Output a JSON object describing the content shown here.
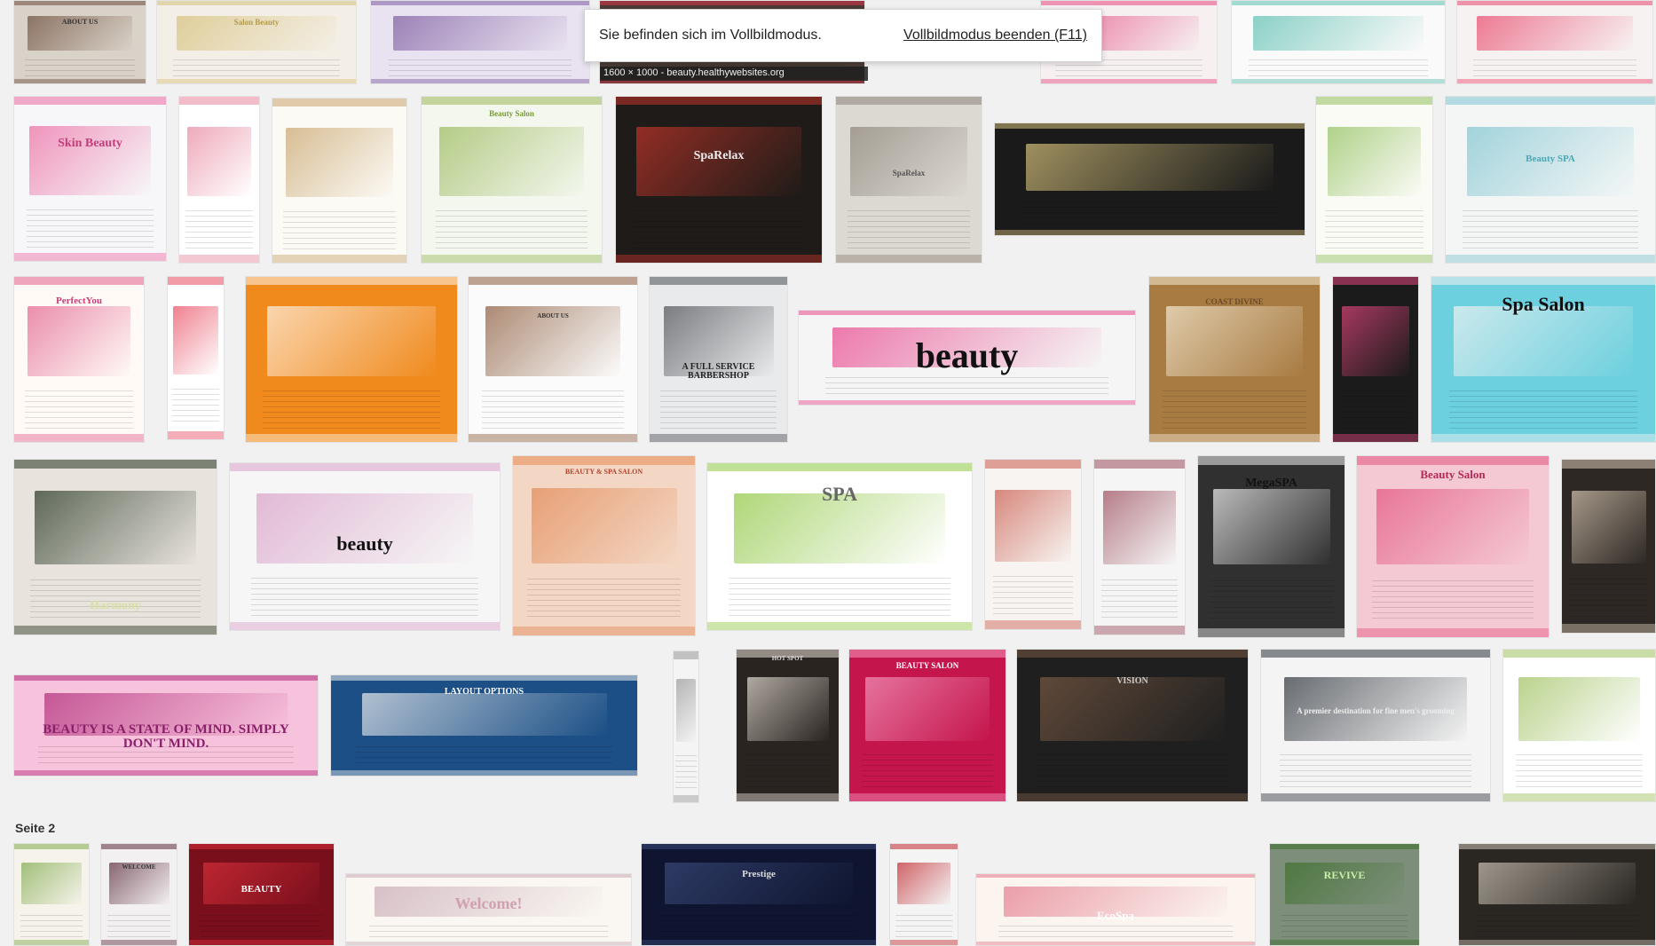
{
  "fullscreen_notice": {
    "message": "Sie befinden sich im Vollbildmodus.",
    "exit_label": "Vollbildmodus beenden (F11)"
  },
  "hover_caption": "1600 × 1000 - beauty.healthywebsites.org",
  "section_label": "Seite 2",
  "thumbnails": [
    {
      "bg": "#d9d2c8",
      "accent": "#6b4b3a",
      "text": "ABOUT US",
      "tc": "#333",
      "tsize": 8,
      "tpos": 22
    },
    {
      "bg": "#f4efe6",
      "accent": "#d6c07a",
      "text": "Salon Beauty",
      "tc": "#b69a4a",
      "tsize": 9,
      "tpos": 22
    },
    {
      "bg": "#e9e2f0",
      "accent": "#7b5aa0",
      "text": "",
      "tc": "#333",
      "tsize": 8,
      "tpos": 40
    },
    {
      "bg": "#4a3c35",
      "accent": "#d8324a",
      "text": "",
      "tc": "#fff",
      "tsize": 8,
      "tpos": 40
    },
    {
      "bg": "#f6f0f1",
      "accent": "#e6457e",
      "text": "",
      "tc": "#333",
      "tsize": 8,
      "tpos": 40
    },
    {
      "bg": "#fafafa",
      "accent": "#5bbfb0",
      "text": "",
      "tc": "#333",
      "tsize": 8,
      "tpos": 40
    },
    {
      "bg": "#f7f2f2",
      "accent": "#e8466a",
      "text": "",
      "tc": "#333",
      "tsize": 8,
      "tpos": 40
    },
    {
      "bg": "#f7f7f9",
      "accent": "#ec6aa2",
      "text": "Skin Beauty",
      "tc": "#c23e7a",
      "tsize": 14,
      "tpos": 25
    },
    {
      "bg": "#fff",
      "accent": "#e7859d",
      "text": "",
      "tc": "#333",
      "tsize": 8,
      "tpos": 40
    },
    {
      "bg": "#fcfaf5",
      "accent": "#c7a36a",
      "text": "",
      "tc": "#333",
      "tsize": 8,
      "tpos": 40
    },
    {
      "bg": "#f3f7ee",
      "accent": "#9ab95a",
      "text": "Beauty Salon",
      "tc": "#7a9a3a",
      "tsize": 9,
      "tpos": 8
    },
    {
      "bg": "#1f1b18",
      "accent": "#c3352a",
      "text": "SpaRelax",
      "tc": "#eee",
      "tsize": 14,
      "tpos": 32
    },
    {
      "bg": "#dcd8d2",
      "accent": "#8b8478",
      "text": "SpaRelax",
      "tc": "#555",
      "tsize": 9,
      "tpos": 44
    },
    {
      "bg": "#1a1a1a",
      "accent": "#d7c27c",
      "text": "",
      "tc": "#fff",
      "tsize": 8,
      "tpos": 40
    },
    {
      "bg": "#fbfbf6",
      "accent": "#8fbf5a",
      "text": "",
      "tc": "#333",
      "tsize": 8,
      "tpos": 40
    },
    {
      "bg": "#f4f6f6",
      "accent": "#7ec4d0",
      "text": "Beauty SPA",
      "tc": "#4aa7b5",
      "tsize": 11,
      "tpos": 35
    },
    {
      "bg": "#fffaf6",
      "accent": "#e25f8d",
      "text": "PerfectYou",
      "tc": "#c84079",
      "tsize": 11,
      "tpos": 12
    },
    {
      "bg": "#fff",
      "accent": "#e84b5f",
      "text": "",
      "tc": "#333",
      "tsize": 8,
      "tpos": 40
    },
    {
      "bg": "#f08a1d",
      "accent": "#fff6ec",
      "text": "",
      "tc": "#fff",
      "tsize": 8,
      "tpos": 40
    },
    {
      "bg": "#fbfbfb",
      "accent": "#8b5a3a",
      "text": "ABOUT US",
      "tc": "#333",
      "tsize": 7,
      "tpos": 22
    },
    {
      "bg": "#e9eaec",
      "accent": "#4b4e52",
      "text": "A FULL SERVICE BARBERSHOP",
      "tc": "#222",
      "tsize": 10,
      "tpos": 52
    },
    {
      "bg": "#f5f5f5",
      "accent": "#e8458c",
      "text": "beauty",
      "tc": "#111",
      "tsize": 40,
      "tpos": 28
    },
    {
      "bg": "#a87b42",
      "accent": "#f6ecd6",
      "text": "COAST DIVINE",
      "tc": "#6a4b28",
      "tsize": 9,
      "tpos": 13
    },
    {
      "bg": "#1b1b1b",
      "accent": "#e2457d",
      "text": "",
      "tc": "#fff",
      "tsize": 8,
      "tpos": 40
    },
    {
      "bg": "#6cd0de",
      "accent": "#f3f3f3",
      "text": "Spa Salon",
      "tc": "#111",
      "tsize": 22,
      "tpos": 10
    },
    {
      "bg": "#e8e3dc",
      "accent": "#233420",
      "text": "Harmony",
      "tc": "#d8e0a8",
      "tsize": 14,
      "tpos": 80
    },
    {
      "bg": "#f6f6f6",
      "accent": "#d9a0c8",
      "text": "beauty",
      "tc": "#111",
      "tsize": 22,
      "tpos": 42
    },
    {
      "bg": "#f3d7c4",
      "accent": "#e38854",
      "text": "BEAUTY & SPA SALON",
      "tc": "#b5412b",
      "tsize": 8,
      "tpos": 7
    },
    {
      "bg": "#ffffff",
      "accent": "#8dc63f",
      "text": "SPA",
      "tc": "#666",
      "tsize": 22,
      "tpos": 12
    },
    {
      "bg": "#f7f4f1",
      "accent": "#c9594a",
      "text": "",
      "tc": "#333",
      "tsize": 8,
      "tpos": 40
    },
    {
      "bg": "#f5f5f5",
      "accent": "#9a4a5a",
      "text": "",
      "tc": "#333",
      "tsize": 8,
      "tpos": 40
    },
    {
      "bg": "#303030",
      "accent": "#f4f4f4",
      "text": "MegaSPA",
      "tc": "#111",
      "tsize": 14,
      "tpos": 12
    },
    {
      "bg": "#f4c9d3",
      "accent": "#e4527f",
      "text": "Beauty Salon",
      "tc": "#b22a57",
      "tsize": 13,
      "tpos": 7
    },
    {
      "bg": "#2e2824",
      "accent": "#d8c8b4",
      "text": "",
      "tc": "#fff",
      "tsize": 8,
      "tpos": 40
    },
    {
      "bg": "#f7c2db",
      "accent": "#b02a7a",
      "text": "BEAUTY IS A STATE OF MIND. SIMPLY DON'T MIND.",
      "tc": "#8a1f6a",
      "tsize": 15,
      "tpos": 48
    },
    {
      "bg": "#1b4f86",
      "accent": "#f0f0f0",
      "text": "LAYOUT OPTIONS",
      "tc": "#fff",
      "tsize": 10,
      "tpos": 12
    },
    {
      "bg": "#f4f4f4",
      "accent": "#999",
      "text": "",
      "tc": "#333",
      "tsize": 8,
      "tpos": 40
    },
    {
      "bg": "#2a2421",
      "accent": "#e9e1d7",
      "text": "HOT SPOT",
      "tc": "#ddd",
      "tsize": 7,
      "tpos": 4
    },
    {
      "bg": "#c4154c",
      "accent": "#f59ac0",
      "text": "BEAUTY SALON",
      "tc": "#fff",
      "tsize": 9,
      "tpos": 8
    },
    {
      "bg": "#1f1f1f",
      "accent": "#7a5a44",
      "text": "VISION",
      "tc": "#ccc",
      "tsize": 10,
      "tpos": 18
    },
    {
      "bg": "#f4f4f4",
      "accent": "#2c3138",
      "text": "A premier destination for fine men's grooming",
      "tc": "#eee",
      "tsize": 9,
      "tpos": 38
    },
    {
      "bg": "#ffffff",
      "accent": "#9cbf5b",
      "text": "",
      "tc": "#333",
      "tsize": 8,
      "tpos": 40
    },
    {
      "bg": "#f5f3ea",
      "accent": "#7ea94a",
      "text": "",
      "tc": "#333",
      "tsize": 8,
      "tpos": 40
    },
    {
      "bg": "#f3f0f1",
      "accent": "#5a2b3a",
      "text": "WELCOME",
      "tc": "#333",
      "tsize": 7,
      "tpos": 20
    },
    {
      "bg": "#7a0f1c",
      "accent": "#d9303a",
      "text": "BEAUTY",
      "tc": "#fff",
      "tsize": 11,
      "tpos": 40
    },
    {
      "bg": "#faf7f2",
      "accent": "#c8a9b5",
      "text": "Welcome!",
      "tc": "#d0a0b0",
      "tsize": 18,
      "tpos": 30
    },
    {
      "bg": "#0f1530",
      "accent": "#3a4a7a",
      "text": "Prestige",
      "tc": "#ddd",
      "tsize": 11,
      "tpos": 25
    },
    {
      "bg": "#f4f4f4",
      "accent": "#c1272d",
      "text": "",
      "tc": "#333",
      "tsize": 8,
      "tpos": 40
    },
    {
      "bg": "#fbf4ef",
      "accent": "#e47a8c",
      "text": "EcoSpa",
      "tc": "#fff",
      "tsize": 13,
      "tpos": 50
    },
    {
      "bg": "#7d8f7a",
      "accent": "#3b6e2a",
      "text": "REVIVE",
      "tc": "#c9f0a8",
      "tsize": 12,
      "tpos": 25
    },
    {
      "bg": "#2a2622",
      "accent": "#cfc6b8",
      "text": "",
      "tc": "#fff",
      "tsize": 8,
      "tpos": 40
    }
  ]
}
